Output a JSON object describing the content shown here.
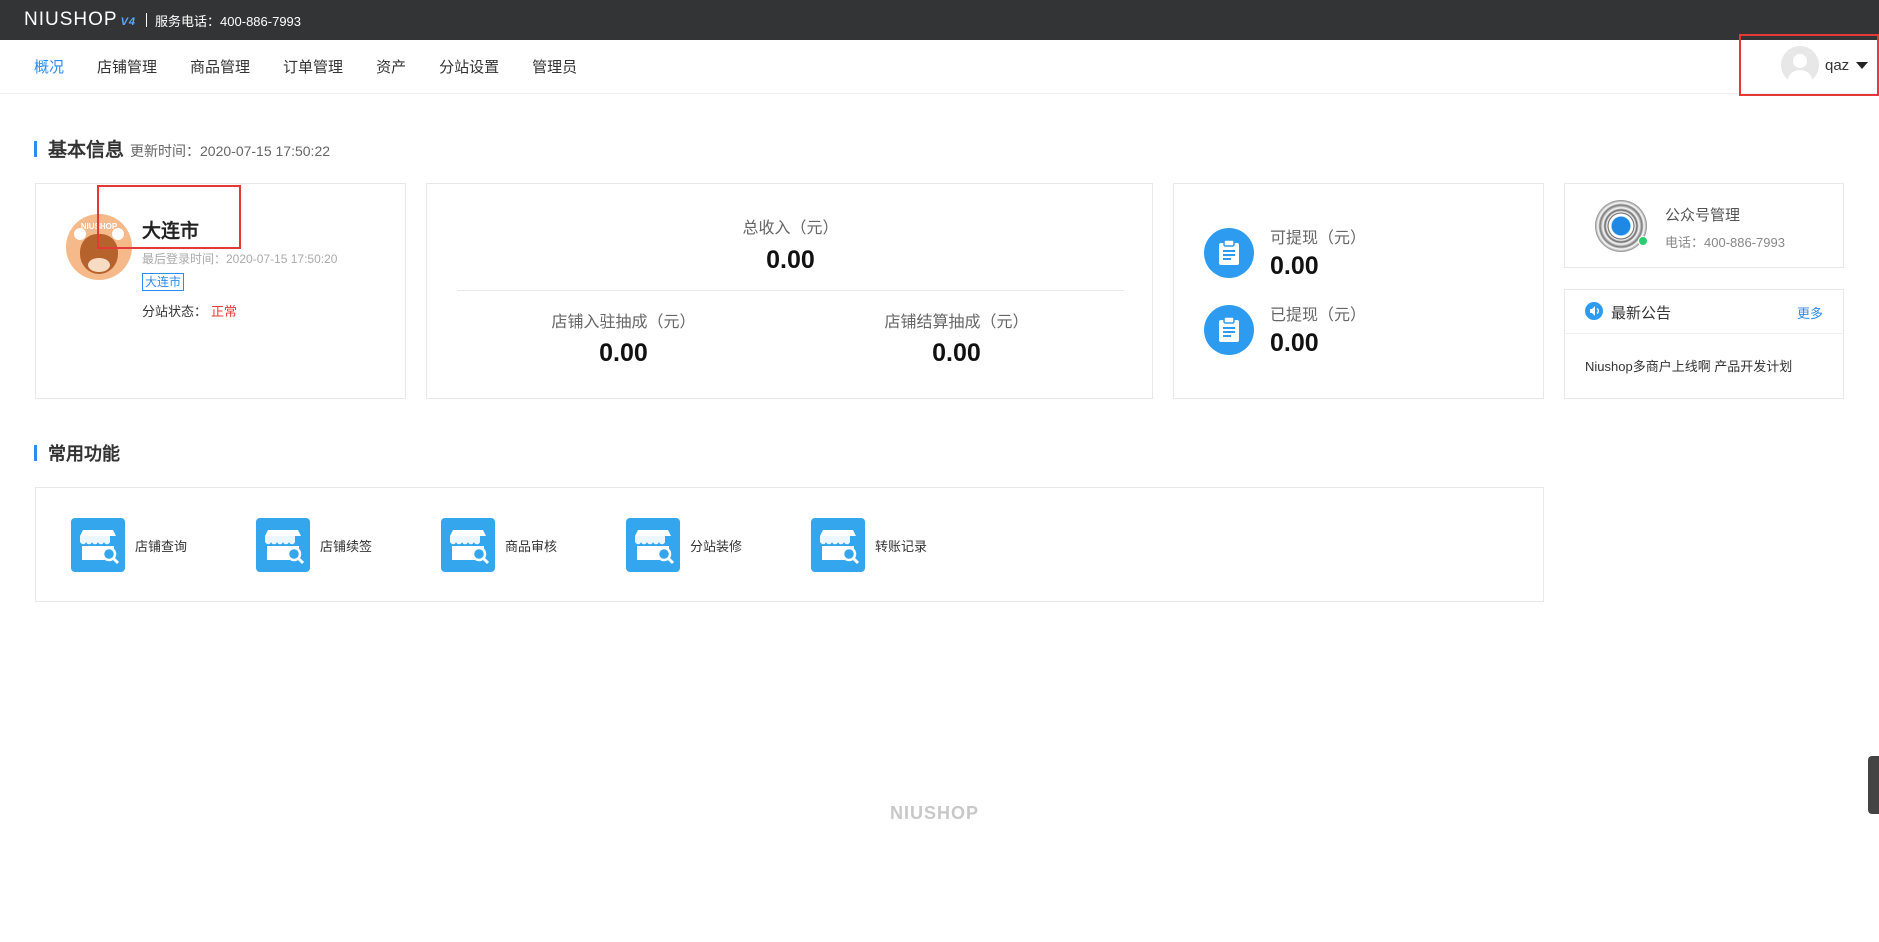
{
  "topbar": {
    "logo": "NIUSHOP",
    "logo_version": "V4",
    "phone": "服务电话：400-886-7993"
  },
  "nav": {
    "items": [
      {
        "label": "概况",
        "active": true
      },
      {
        "label": "店铺管理"
      },
      {
        "label": "商品管理"
      },
      {
        "label": "订单管理"
      },
      {
        "label": "资产"
      },
      {
        "label": "分站设置"
      },
      {
        "label": "管理员"
      }
    ],
    "user": "qaz"
  },
  "basic_info": {
    "title": "基本信息",
    "updated": "更新时间：2020-07-15 17:50:22"
  },
  "profile": {
    "avatar_text": "NIUSHOP",
    "name": "大连市",
    "last_login": "最后登录时间：2020-07-15 17:50:20",
    "tag": "大连市",
    "status_label": "分站状态：",
    "status_value": "正常"
  },
  "income": {
    "total_label": "总收入（元）",
    "total_value": "0.00",
    "settle_label": "店铺入驻抽成（元）",
    "settle_value": "0.00",
    "settlement_label": "店铺结算抽成（元）",
    "settlement_value": "0.00"
  },
  "withdraw": {
    "available_label": "可提现（元）",
    "available_value": "0.00",
    "done_label": "已提现（元）",
    "done_value": "0.00"
  },
  "wechat": {
    "title": "公众号管理",
    "phone": "电话：400-886-7993"
  },
  "announcement": {
    "title": "最新公告",
    "more": "更多",
    "item": "Niushop多商户上线啊 产品开发计划"
  },
  "common": {
    "title": "常用功能",
    "items": [
      "店铺查询",
      "店铺续签",
      "商品审核",
      "分站装修",
      "转账记录"
    ]
  },
  "footer": {
    "logo": "NIUSHOP"
  },
  "colors": {
    "accent": "#2d8cf0",
    "topbar": "#333436",
    "danger": "#e53935",
    "icon_blue": "#34a6ee"
  }
}
